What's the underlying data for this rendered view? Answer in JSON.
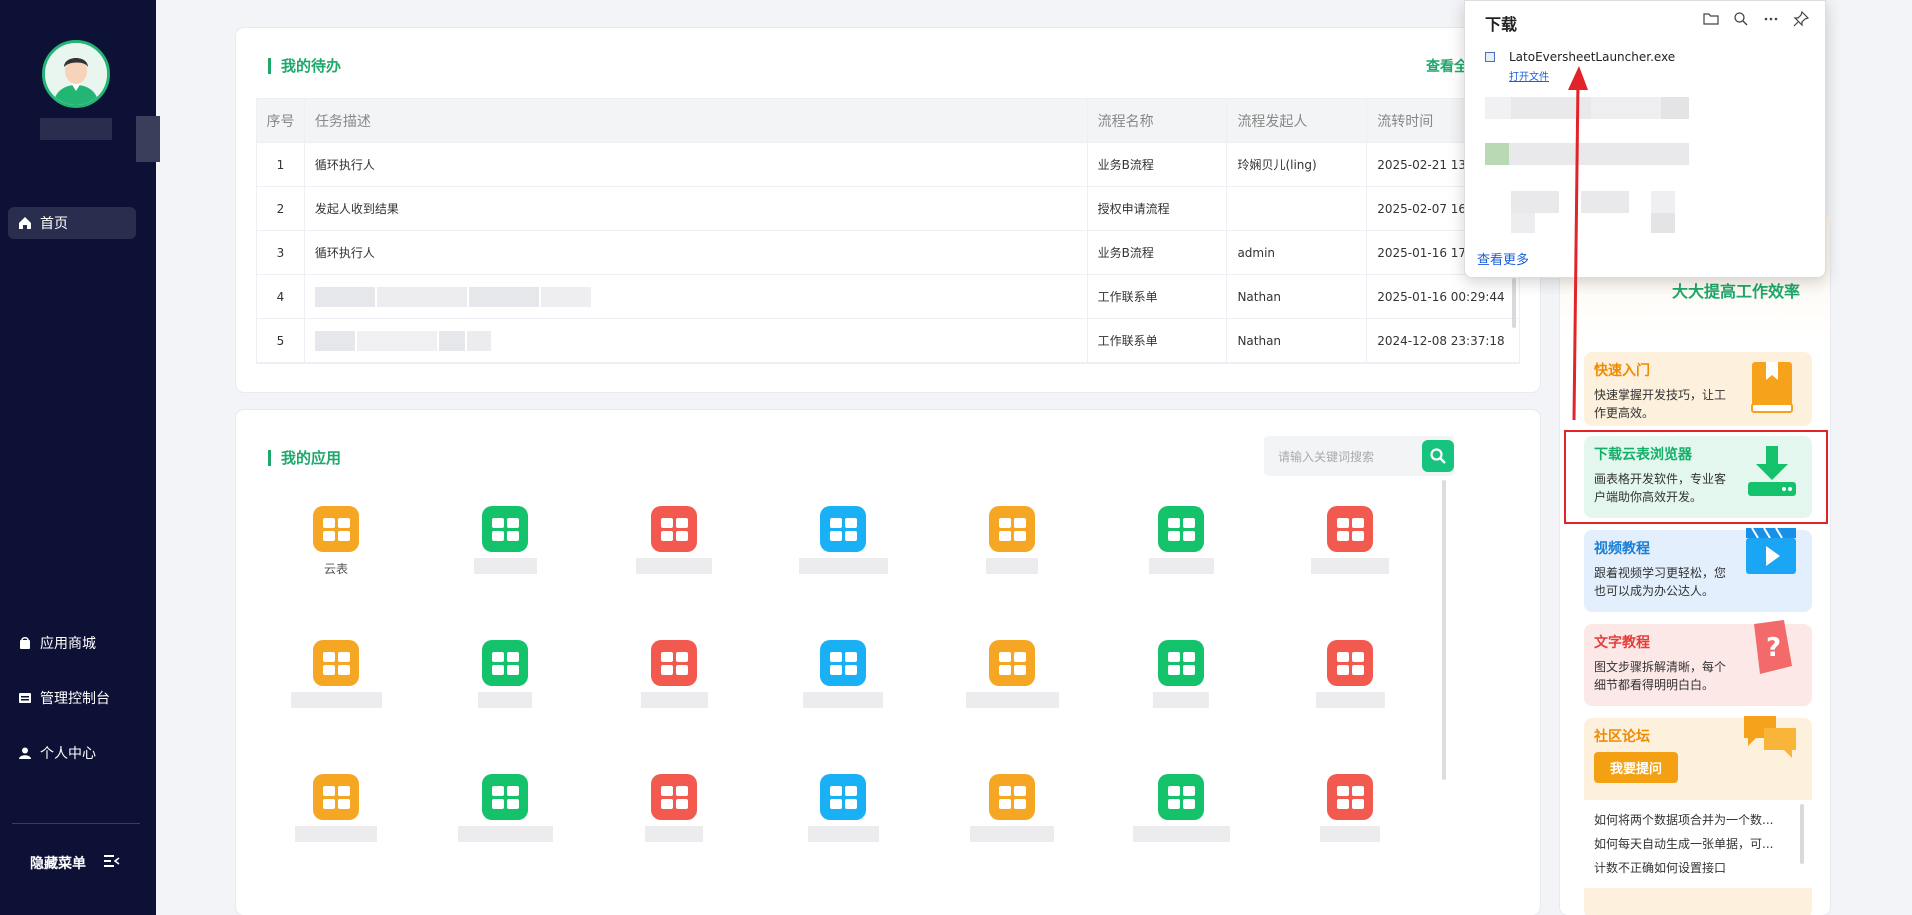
{
  "sidebar": {
    "items": [
      {
        "label": "首页",
        "icon": "home-icon"
      },
      {
        "label": "应用商城",
        "icon": "store-icon"
      },
      {
        "label": "管理控制台",
        "icon": "console-icon"
      },
      {
        "label": "个人中心",
        "icon": "user-icon"
      }
    ],
    "hide_menu": "隐藏菜单"
  },
  "todo": {
    "title": "我的待办",
    "view_all": "查看全",
    "columns": [
      "序号",
      "任务描述",
      "流程名称",
      "流程发起人",
      "流转时间"
    ],
    "rows": [
      {
        "no": "1",
        "desc": "循环执行人",
        "flow": "业务B流程",
        "initiator": "玲娴贝儿(ling)",
        "time": "2025-02-21 13:"
      },
      {
        "no": "2",
        "desc": "发起人收到结果",
        "flow": "授权申请流程",
        "initiator": "",
        "time": "2025-02-07 16"
      },
      {
        "no": "3",
        "desc": "循环执行人",
        "flow": "业务B流程",
        "initiator": "admin",
        "time": "2025-01-16 17:"
      },
      {
        "no": "4",
        "desc": "",
        "flow": "工作联系单",
        "initiator": "Nathan",
        "time": "2025-01-16 00:29:44"
      },
      {
        "no": "5",
        "desc": "",
        "flow": "工作联系单",
        "initiator": "Nathan",
        "time": "2024-12-08 23:37:18"
      }
    ]
  },
  "apps": {
    "title": "我的应用",
    "search_placeholder": "请输入关键词搜索",
    "first_label": "云表",
    "colors": [
      "#f5a623",
      "#14c26b",
      "#f35a4f",
      "#1ab0f5",
      "#f5a623",
      "#14c26b",
      "#f35a4f"
    ]
  },
  "right": {
    "banner": "大大提高工作效率",
    "cards": [
      {
        "title": "快速入门",
        "desc": "快速掌握开发技巧，让工作更高效。",
        "color": "#f08a00"
      },
      {
        "title": "下载云表浏览器",
        "desc": "画表格开发软件，专业客户端助你高效开发。",
        "color": "#14b06a"
      },
      {
        "title": "视频教程",
        "desc": "跟着视频学习更轻松，您也可以成为办公达人。",
        "color": "#1a7fd6"
      },
      {
        "title": "文字教程",
        "desc": "图文步骤拆解清晰，每个细节都看得明明白白。",
        "color": "#e2403c"
      },
      {
        "title": "社区论坛",
        "desc": "",
        "color": "#f08a00"
      }
    ],
    "ask_button": "我要提问",
    "forum": [
      "如何将两个数据项合并为一个数...",
      "如何每天自动生成一张单据，可...",
      "计数不正确如何设置接口"
    ]
  },
  "download": {
    "title": "下载",
    "file": "LatoEversheetLauncher.exe",
    "open": "打开文件",
    "more": "查看更多"
  }
}
